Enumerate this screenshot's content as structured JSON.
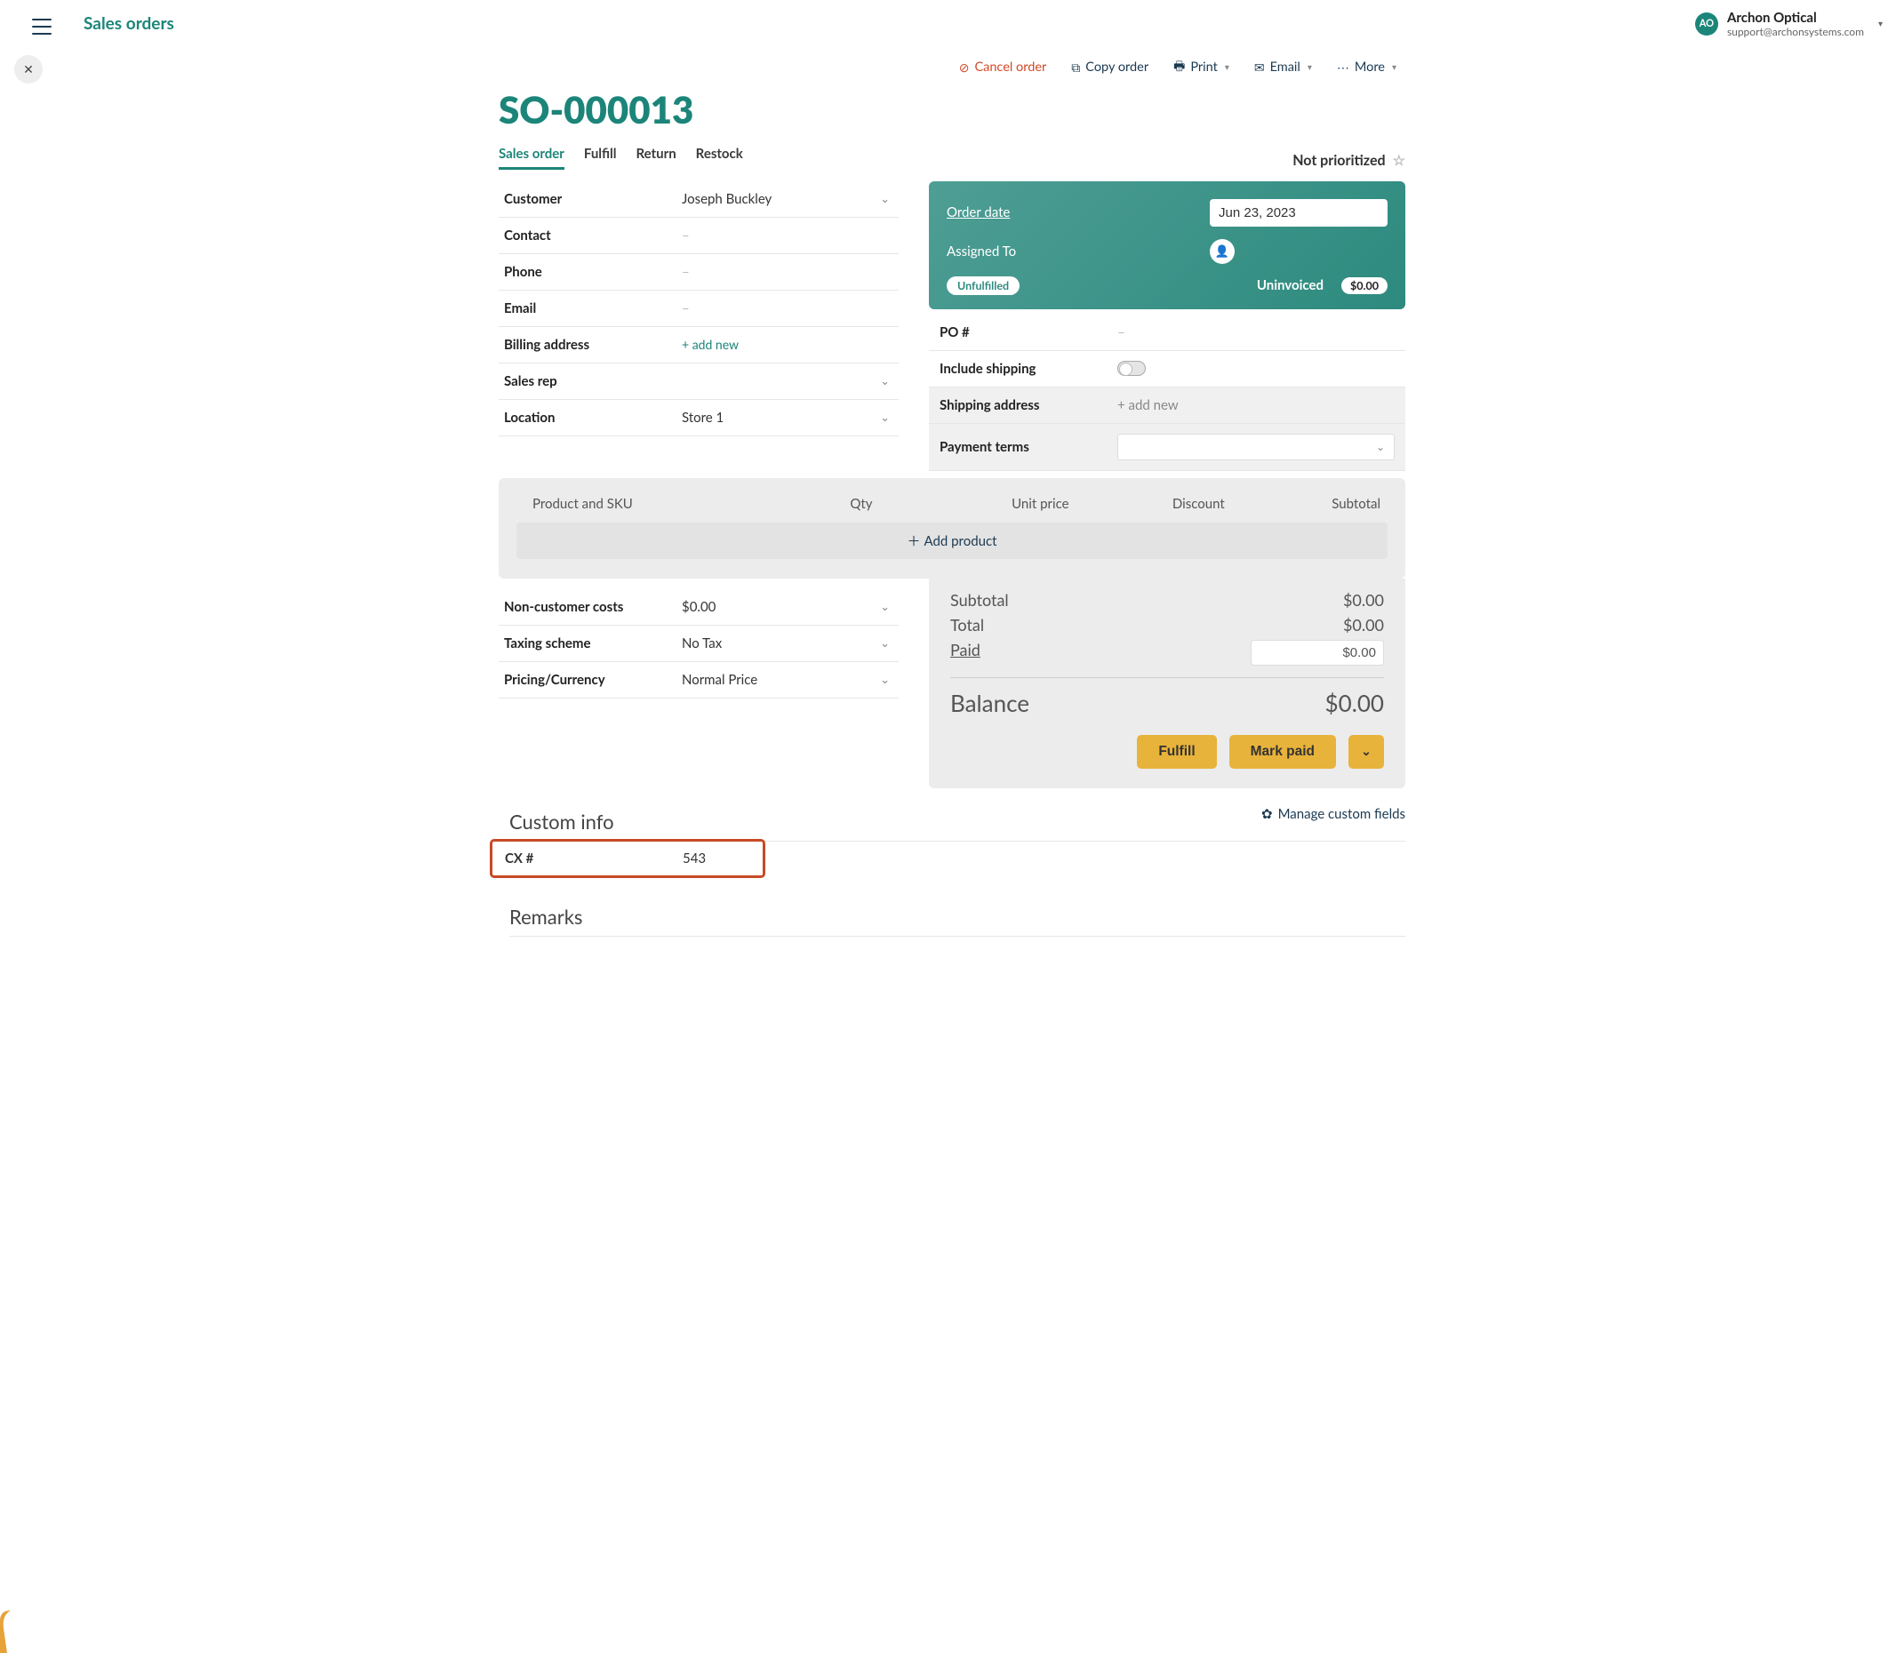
{
  "page_title": "Sales orders",
  "account": {
    "initials": "AO",
    "name": "Archon Optical",
    "email": "support@archonsystems.com"
  },
  "toolbar": {
    "cancel": "Cancel order",
    "copy": "Copy order",
    "print": "Print",
    "email": "Email",
    "more": "More"
  },
  "order": {
    "number": "SO-000013"
  },
  "tabs": [
    "Sales order",
    "Fulfill",
    "Return",
    "Restock"
  ],
  "priority": {
    "label": "Not prioritized"
  },
  "left_fields": {
    "customer": {
      "label": "Customer",
      "value": "Joseph Buckley"
    },
    "contact": {
      "label": "Contact",
      "value": "–"
    },
    "phone": {
      "label": "Phone",
      "value": "–"
    },
    "email": {
      "label": "Email",
      "value": "–"
    },
    "billing": {
      "label": "Billing address",
      "value": "+ add new"
    },
    "salesrep": {
      "label": "Sales rep",
      "value": ""
    },
    "location": {
      "label": "Location",
      "value": "Store 1"
    }
  },
  "right_card": {
    "order_date_label": "Order date",
    "order_date": "Jun 23, 2023",
    "assigned_label": "Assigned To",
    "unfulfilled": "Unfulfilled",
    "uninvoiced": "Uninvoiced",
    "amount": "$0.00"
  },
  "right_fields": {
    "po": {
      "label": "PO #",
      "value": "–"
    },
    "shipping": {
      "label": "Include shipping"
    },
    "shipaddr": {
      "label": "Shipping address",
      "value": "+ add new"
    },
    "terms": {
      "label": "Payment terms"
    }
  },
  "products": {
    "headers": [
      "Product and SKU",
      "Qty",
      "Unit price",
      "Discount",
      "Subtotal"
    ],
    "add": "Add product"
  },
  "cost_fields": {
    "noncust": {
      "label": "Non-customer costs",
      "value": "$0.00"
    },
    "tax": {
      "label": "Taxing scheme",
      "value": "No Tax"
    },
    "pricing": {
      "label": "Pricing/Currency",
      "value": "Normal Price"
    }
  },
  "totals": {
    "subtotal": {
      "label": "Subtotal",
      "value": "$0.00"
    },
    "total": {
      "label": "Total",
      "value": "$0.00"
    },
    "paid": {
      "label": "Paid",
      "value": "$0.00"
    },
    "balance": {
      "label": "Balance",
      "value": "$0.00"
    }
  },
  "actions": {
    "fulfill": "Fulfill",
    "markpaid": "Mark paid"
  },
  "custom": {
    "title": "Custom info",
    "manage": "Manage custom fields",
    "row": {
      "label": "CX #",
      "value": "543"
    }
  },
  "remarks_title": "Remarks"
}
